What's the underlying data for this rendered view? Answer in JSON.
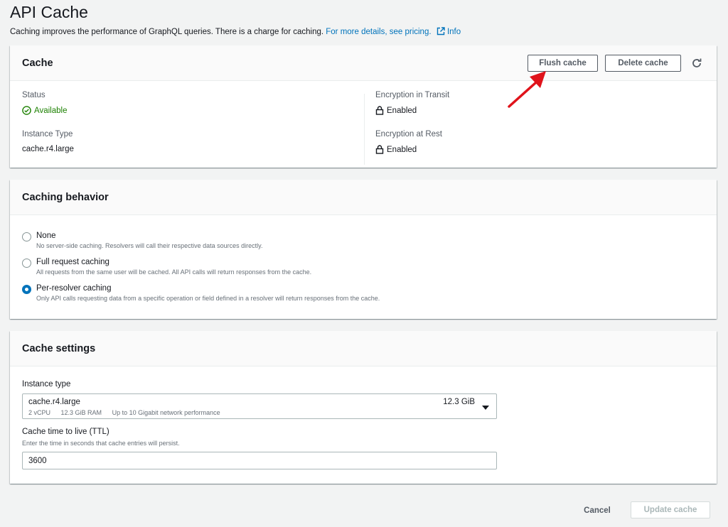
{
  "page": {
    "title": "API Cache",
    "description": "Caching improves the performance of GraphQL queries. There is a charge for caching.",
    "pricing_link": "For more details, see pricing.",
    "info_link": "Info"
  },
  "cache_panel": {
    "title": "Cache",
    "flush_button": "Flush cache",
    "delete_button": "Delete cache",
    "status_label": "Status",
    "status_value": "Available",
    "instance_type_label": "Instance Type",
    "instance_type_value": "cache.r4.large",
    "transit_label": "Encryption in Transit",
    "transit_value": "Enabled",
    "rest_label": "Encryption at Rest",
    "rest_value": "Enabled"
  },
  "behavior_panel": {
    "title": "Caching behavior",
    "options": [
      {
        "label": "None",
        "description": "No server-side caching. Resolvers will call their respective data sources directly.",
        "checked": false
      },
      {
        "label": "Full request caching",
        "description": "All requests from the same user will be cached. All API calls will return responses from the cache.",
        "checked": false
      },
      {
        "label": "Per-resolver caching",
        "description": "Only API calls requesting data from a specific operation or field defined in a resolver will return responses from the cache.",
        "checked": true
      }
    ]
  },
  "settings_panel": {
    "title": "Cache settings",
    "instance_type_label": "Instance type",
    "instance_selected": "cache.r4.large",
    "instance_size": "12.3 GiB",
    "instance_vcpu": "2 vCPU",
    "instance_ram": "12.3 GiB RAM",
    "instance_network": "Up to 10 Gigabit network performance",
    "ttl_label": "Cache time to live (TTL)",
    "ttl_hint": "Enter the time in seconds that cache entries will persist.",
    "ttl_value": "3600"
  },
  "footer": {
    "cancel_label": "Cancel",
    "update_label": "Update cache"
  },
  "colors": {
    "link": "#0073bb",
    "success": "#1d8102",
    "annotation_arrow": "#e0131b",
    "selected_radio": "#0073bb"
  }
}
